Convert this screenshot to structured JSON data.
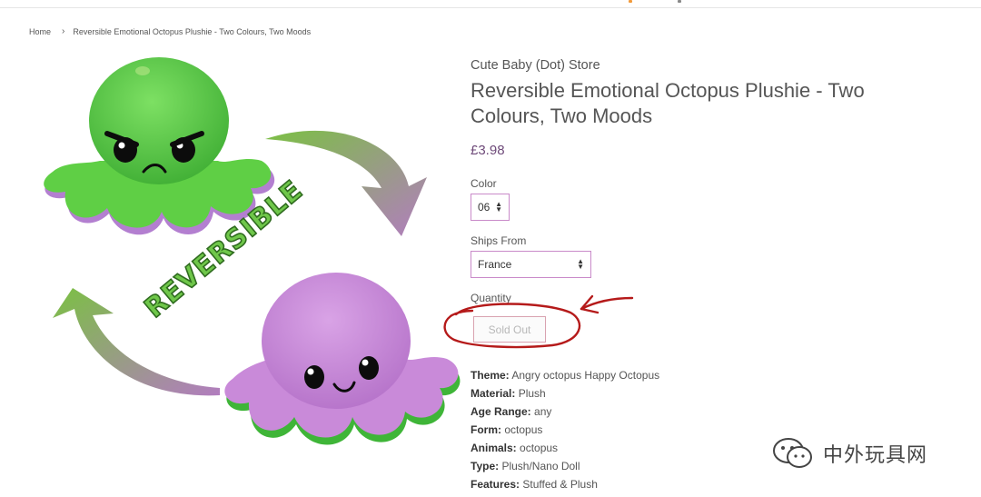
{
  "breadcrumb": {
    "home": "Home",
    "separator": "›",
    "current": "Reversible Emotional Octopus Plushie - Two Colours, Two Moods"
  },
  "product": {
    "vendor": "Cute Baby (Dot) Store",
    "title": "Reversible Emotional Octopus Plushie - Two Colours, Two Moods",
    "price": "£3.98",
    "image_text": "REVERSIBLE",
    "options": {
      "color_label": "Color",
      "color_value": "06",
      "ships_from_label": "Ships From",
      "ships_from_value": "France",
      "quantity_label": "Quantity"
    },
    "sold_out_label": "Sold Out",
    "specs": [
      {
        "label": "Theme:",
        "value": " Angry octopus Happy Octopus"
      },
      {
        "label": "Material:",
        "value": " Plush"
      },
      {
        "label": "Age Range:",
        "value": " any"
      },
      {
        "label": "Form:",
        "value": " octopus"
      },
      {
        "label": "Animals:",
        "value": " octopus"
      },
      {
        "label": "Type:",
        "value": " Plush/Nano Doll"
      },
      {
        "label": "Features:",
        "value": " Stuffed & Plush"
      }
    ]
  },
  "watermark": {
    "text": "中外玩具网",
    "icon": "wechat-icon"
  },
  "colors": {
    "accent_purple": "#6f4b7a",
    "select_border": "#c98ac9",
    "annotation_red": "#b51a1a",
    "octopus_green": "#59c947",
    "octopus_purple": "#c47fd6"
  }
}
